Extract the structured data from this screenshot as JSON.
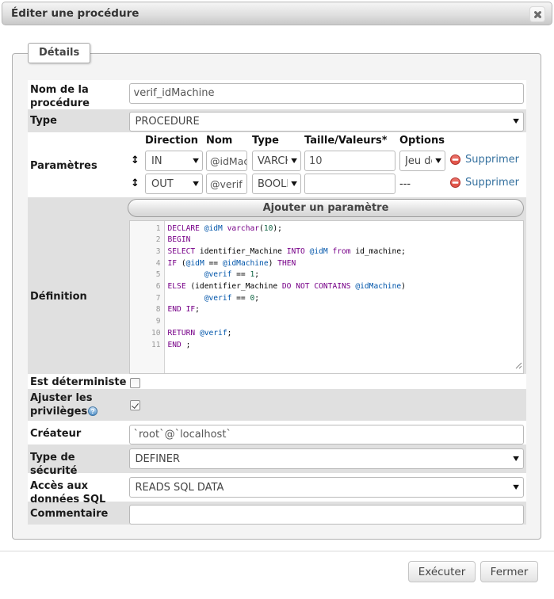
{
  "dialog": {
    "title": "Éditer une procédure"
  },
  "tab": {
    "label": "Détails"
  },
  "icons": {
    "select_arrow": "▼",
    "drag_handle": "↕"
  },
  "fields": {
    "name": {
      "label": "Nom de la procédure",
      "value": "verif_idMachine"
    },
    "type": {
      "label": "Type",
      "value": "PROCEDURE"
    },
    "parameters": {
      "label": "Paramètres",
      "headers": {
        "direction": "Direction",
        "name": "Nom",
        "type": "Type",
        "length": "Taille/Valeurs*",
        "options": "Options"
      },
      "rows": [
        {
          "direction": "IN",
          "name": "@idMachine",
          "type": "VARCHAR",
          "length": "10",
          "options": "Jeu de caractères",
          "remove_label": "Supprimer"
        },
        {
          "direction": "OUT",
          "name": "@verif",
          "type": "BOOLEAN",
          "length": "",
          "options": "---",
          "remove_label": "Supprimer"
        }
      ],
      "add_button": "Ajouter un paramètre"
    },
    "definition": {
      "label": "Définition",
      "lines": [
        [
          [
            "k",
            "DECLARE"
          ],
          [
            "t",
            " "
          ],
          [
            "v",
            "@idM"
          ],
          [
            "t",
            " "
          ],
          [
            "k",
            "varchar"
          ],
          [
            "t",
            "("
          ],
          [
            "n",
            "10"
          ],
          [
            "t",
            ");"
          ]
        ],
        [
          [
            "k",
            "BEGIN"
          ]
        ],
        [
          [
            "k",
            "SELECT"
          ],
          [
            "t",
            " identifier_Machine "
          ],
          [
            "k",
            "INTO"
          ],
          [
            "t",
            " "
          ],
          [
            "v",
            "@idM"
          ],
          [
            "t",
            " "
          ],
          [
            "k",
            "from"
          ],
          [
            "t",
            " id_machine;"
          ]
        ],
        [
          [
            "k",
            "IF"
          ],
          [
            "t",
            " ("
          ],
          [
            "v",
            "@idM"
          ],
          [
            "t",
            " == "
          ],
          [
            "v",
            "@idMachine"
          ],
          [
            "t",
            ") "
          ],
          [
            "k",
            "THEN"
          ]
        ],
        [
          [
            "t",
            "        "
          ],
          [
            "v",
            "@verif"
          ],
          [
            "t",
            " == "
          ],
          [
            "n",
            "1"
          ],
          [
            "t",
            ";"
          ]
        ],
        [
          [
            "k",
            "ELSE"
          ],
          [
            "t",
            " (identifier_Machine "
          ],
          [
            "k",
            "DO"
          ],
          [
            "t",
            " "
          ],
          [
            "k",
            "NOT"
          ],
          [
            "t",
            " "
          ],
          [
            "k",
            "CONTAINS"
          ],
          [
            "t",
            " "
          ],
          [
            "v",
            "@idMachine"
          ],
          [
            "t",
            ")"
          ]
        ],
        [
          [
            "t",
            "        "
          ],
          [
            "v",
            "@verif"
          ],
          [
            "t",
            " == "
          ],
          [
            "n",
            "0"
          ],
          [
            "t",
            ";"
          ]
        ],
        [
          [
            "k",
            "END"
          ],
          [
            "t",
            " "
          ],
          [
            "k",
            "IF"
          ],
          [
            "t",
            ";"
          ]
        ],
        [],
        [
          [
            "k",
            "RETURN"
          ],
          [
            "t",
            " "
          ],
          [
            "v",
            "@verif"
          ],
          [
            "t",
            ";"
          ]
        ],
        [
          [
            "k",
            "END"
          ],
          [
            "t",
            " ;"
          ]
        ]
      ]
    },
    "deterministic": {
      "label": "Est déterministe",
      "checked": false
    },
    "adjust_privileges": {
      "label": "Ajuster les privilèges",
      "checked": true
    },
    "creator": {
      "label": "Créateur",
      "value": "`root`@`localhost`"
    },
    "security_type": {
      "label": "Type de sécurité",
      "value": "DEFINER"
    },
    "sql_data_access": {
      "label": "Accès aux données SQL",
      "value": "READS SQL DATA"
    },
    "comment": {
      "label": "Commentaire",
      "value": ""
    }
  },
  "buttons": {
    "execute": "Exécuter",
    "close": "Fermer"
  }
}
